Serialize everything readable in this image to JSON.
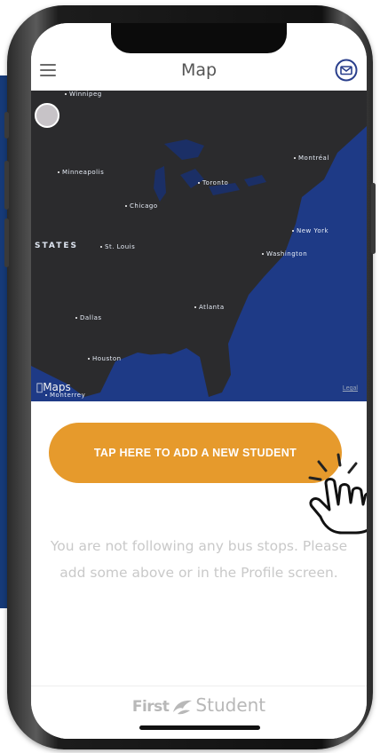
{
  "header": {
    "title": "Map",
    "menu_icon": "hamburger-menu-icon",
    "mail_icon": "envelope-icon",
    "accent": "#2a3f8c"
  },
  "map": {
    "region_label": "STATES",
    "cities": [
      "Winnipeg",
      "Montréal",
      "Minneapolis",
      "Toronto",
      "Chicago",
      "New York",
      "St. Louis",
      "Washington",
      "Atlanta",
      "Dallas",
      "Houston",
      "Monterrey"
    ],
    "attribution": "Maps",
    "legal": "Legal",
    "water_color": "#1e3a86",
    "land_color": "#2b2b2d"
  },
  "cta": {
    "label": "TAP HERE TO ADD A NEW STUDENT",
    "color": "#e69a2c"
  },
  "empty_state": {
    "message": "You are not following any bus stops. Please add some above or in the Profile screen."
  },
  "brand": {
    "first": "First",
    "student": "Student"
  }
}
